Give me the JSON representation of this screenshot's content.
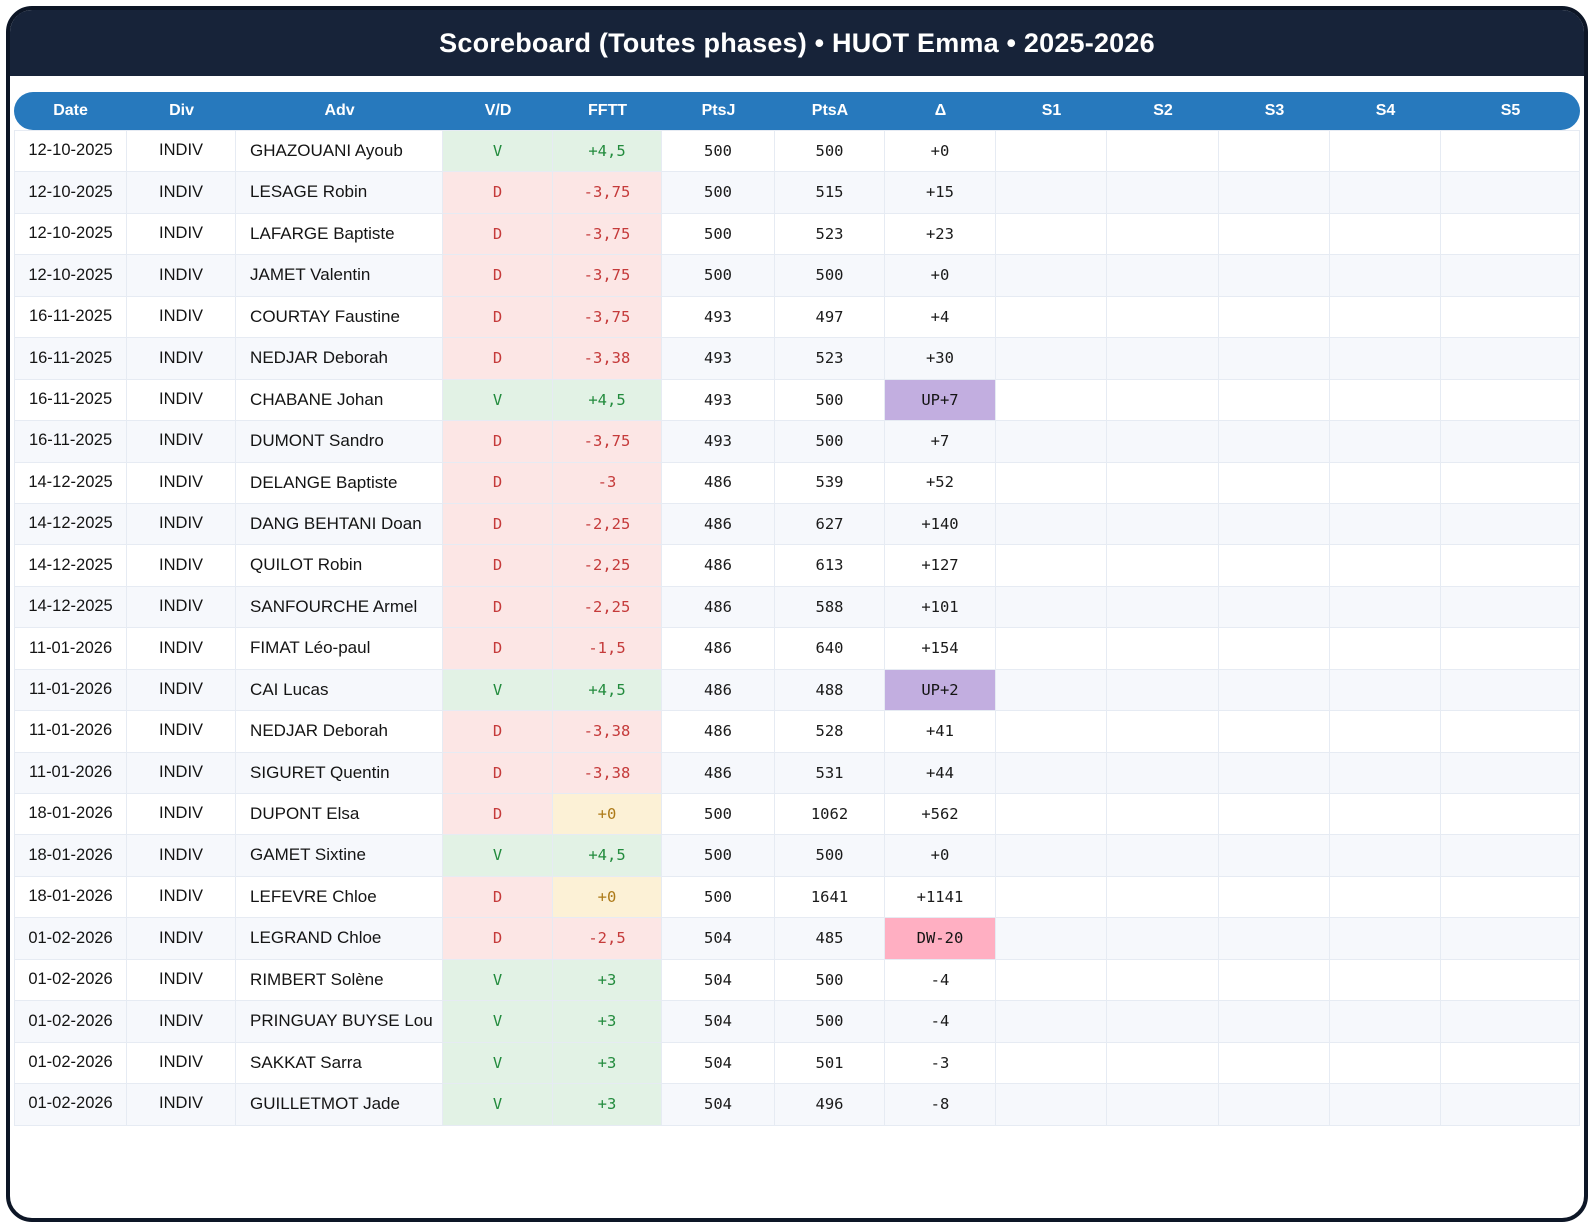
{
  "title": "Scoreboard (Toutes phases) • HUOT Emma • 2025-2026",
  "columns": [
    "Date",
    "Div",
    "Adv",
    "V/D",
    "FFTT",
    "PtsJ",
    "PtsA",
    "Δ",
    "S1",
    "S2",
    "S3",
    "S4",
    "S5"
  ],
  "colors": {
    "title_bar_bg": "#172339",
    "header_bg": "#2779bd",
    "win_bg": "#e2f2e5",
    "win_text": "#228b3d",
    "loss_bg": "#fce6e5",
    "loss_text": "#c53a3a",
    "zero_bg": "#fcf1d6",
    "zero_text": "#ad7a18",
    "up_badge_bg": "#c2aee0",
    "down_badge_bg": "#ffafc2",
    "row_stripe": "#f6f8fc"
  },
  "rows": [
    {
      "date": "12-10-2025",
      "div": "INDIV",
      "adv": "GHAZOUANI Ayoub",
      "vd": "V",
      "fftt": "+4,5",
      "ptsj": "500",
      "ptsa": "500",
      "delta": "+0",
      "fk": "pos",
      "dk": "plain"
    },
    {
      "date": "12-10-2025",
      "div": "INDIV",
      "adv": "LESAGE Robin",
      "vd": "D",
      "fftt": "-3,75",
      "ptsj": "500",
      "ptsa": "515",
      "delta": "+15",
      "fk": "neg",
      "dk": "plain"
    },
    {
      "date": "12-10-2025",
      "div": "INDIV",
      "adv": "LAFARGE Baptiste",
      "vd": "D",
      "fftt": "-3,75",
      "ptsj": "500",
      "ptsa": "523",
      "delta": "+23",
      "fk": "neg",
      "dk": "plain"
    },
    {
      "date": "12-10-2025",
      "div": "INDIV",
      "adv": "JAMET Valentin",
      "vd": "D",
      "fftt": "-3,75",
      "ptsj": "500",
      "ptsa": "500",
      "delta": "+0",
      "fk": "neg",
      "dk": "plain"
    },
    {
      "date": "16-11-2025",
      "div": "INDIV",
      "adv": "COURTAY Faustine",
      "vd": "D",
      "fftt": "-3,75",
      "ptsj": "493",
      "ptsa": "497",
      "delta": "+4",
      "fk": "neg",
      "dk": "plain"
    },
    {
      "date": "16-11-2025",
      "div": "INDIV",
      "adv": "NEDJAR Deborah",
      "vd": "D",
      "fftt": "-3,38",
      "ptsj": "493",
      "ptsa": "523",
      "delta": "+30",
      "fk": "neg",
      "dk": "plain"
    },
    {
      "date": "16-11-2025",
      "div": "INDIV",
      "adv": "CHABANE Johan",
      "vd": "V",
      "fftt": "+4,5",
      "ptsj": "493",
      "ptsa": "500",
      "delta": "UP+7",
      "fk": "pos",
      "dk": "up"
    },
    {
      "date": "16-11-2025",
      "div": "INDIV",
      "adv": "DUMONT Sandro",
      "vd": "D",
      "fftt": "-3,75",
      "ptsj": "493",
      "ptsa": "500",
      "delta": "+7",
      "fk": "neg",
      "dk": "plain"
    },
    {
      "date": "14-12-2025",
      "div": "INDIV",
      "adv": "DELANGE Baptiste",
      "vd": "D",
      "fftt": "-3",
      "ptsj": "486",
      "ptsa": "539",
      "delta": "+52",
      "fk": "neg",
      "dk": "plain"
    },
    {
      "date": "14-12-2025",
      "div": "INDIV",
      "adv": "DANG BEHTANI Doan",
      "vd": "D",
      "fftt": "-2,25",
      "ptsj": "486",
      "ptsa": "627",
      "delta": "+140",
      "fk": "neg",
      "dk": "plain"
    },
    {
      "date": "14-12-2025",
      "div": "INDIV",
      "adv": "QUILOT Robin",
      "vd": "D",
      "fftt": "-2,25",
      "ptsj": "486",
      "ptsa": "613",
      "delta": "+127",
      "fk": "neg",
      "dk": "plain"
    },
    {
      "date": "14-12-2025",
      "div": "INDIV",
      "adv": "SANFOURCHE Armel",
      "vd": "D",
      "fftt": "-2,25",
      "ptsj": "486",
      "ptsa": "588",
      "delta": "+101",
      "fk": "neg",
      "dk": "plain"
    },
    {
      "date": "11-01-2026",
      "div": "INDIV",
      "adv": "FIMAT Léo-paul",
      "vd": "D",
      "fftt": "-1,5",
      "ptsj": "486",
      "ptsa": "640",
      "delta": "+154",
      "fk": "neg",
      "dk": "plain"
    },
    {
      "date": "11-01-2026",
      "div": "INDIV",
      "adv": "CAI Lucas",
      "vd": "V",
      "fftt": "+4,5",
      "ptsj": "486",
      "ptsa": "488",
      "delta": "UP+2",
      "fk": "pos",
      "dk": "up"
    },
    {
      "date": "11-01-2026",
      "div": "INDIV",
      "adv": "NEDJAR Deborah",
      "vd": "D",
      "fftt": "-3,38",
      "ptsj": "486",
      "ptsa": "528",
      "delta": "+41",
      "fk": "neg",
      "dk": "plain"
    },
    {
      "date": "11-01-2026",
      "div": "INDIV",
      "adv": "SIGURET Quentin",
      "vd": "D",
      "fftt": "-3,38",
      "ptsj": "486",
      "ptsa": "531",
      "delta": "+44",
      "fk": "neg",
      "dk": "plain"
    },
    {
      "date": "18-01-2026",
      "div": "INDIV",
      "adv": "DUPONT Elsa",
      "vd": "D",
      "fftt": "+0",
      "ptsj": "500",
      "ptsa": "1062",
      "delta": "+562",
      "fk": "zero",
      "dk": "plain"
    },
    {
      "date": "18-01-2026",
      "div": "INDIV",
      "adv": "GAMET Sixtine",
      "vd": "V",
      "fftt": "+4,5",
      "ptsj": "500",
      "ptsa": "500",
      "delta": "+0",
      "fk": "pos",
      "dk": "plain"
    },
    {
      "date": "18-01-2026",
      "div": "INDIV",
      "adv": "LEFEVRE Chloe",
      "vd": "D",
      "fftt": "+0",
      "ptsj": "500",
      "ptsa": "1641",
      "delta": "+1141",
      "fk": "zero",
      "dk": "plain"
    },
    {
      "date": "01-02-2026",
      "div": "INDIV",
      "adv": "LEGRAND Chloe",
      "vd": "D",
      "fftt": "-2,5",
      "ptsj": "504",
      "ptsa": "485",
      "delta": "DW-20",
      "fk": "neg",
      "dk": "down"
    },
    {
      "date": "01-02-2026",
      "div": "INDIV",
      "adv": "RIMBERT Solène",
      "vd": "V",
      "fftt": "+3",
      "ptsj": "504",
      "ptsa": "500",
      "delta": "-4",
      "fk": "pos",
      "dk": "plain"
    },
    {
      "date": "01-02-2026",
      "div": "INDIV",
      "adv": "PRINGUAY BUYSE Lou",
      "vd": "V",
      "fftt": "+3",
      "ptsj": "504",
      "ptsa": "500",
      "delta": "-4",
      "fk": "pos",
      "dk": "plain"
    },
    {
      "date": "01-02-2026",
      "div": "INDIV",
      "adv": "SAKKAT Sarra",
      "vd": "V",
      "fftt": "+3",
      "ptsj": "504",
      "ptsa": "501",
      "delta": "-3",
      "fk": "pos",
      "dk": "plain"
    },
    {
      "date": "01-02-2026",
      "div": "INDIV",
      "adv": "GUILLETMOT Jade",
      "vd": "V",
      "fftt": "+3",
      "ptsj": "504",
      "ptsa": "496",
      "delta": "-8",
      "fk": "pos",
      "dk": "plain"
    }
  ]
}
